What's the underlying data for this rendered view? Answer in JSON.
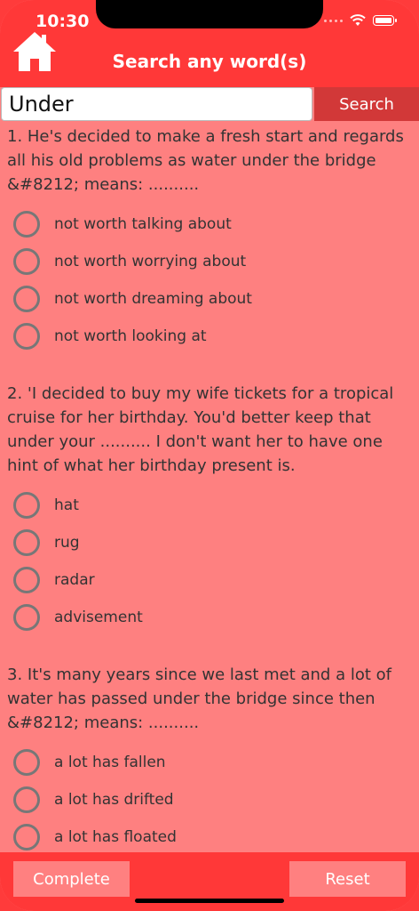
{
  "status": {
    "time": "10:30"
  },
  "header": {
    "title": "Search any word(s)"
  },
  "search": {
    "value": "Under",
    "button_label": "Search"
  },
  "questions": [
    {
      "text": "1. He's decided to make a fresh start and regards all his old problems as water under the bridge &#8212; means: ..........",
      "options": [
        "not worth talking about",
        "not worth worrying about",
        "not worth dreaming about",
        "not worth looking at"
      ]
    },
    {
      "text": "2. 'I decided to buy my wife tickets for a tropical cruise for her birthday. You'd better keep that under your .......... I don't want her to have one hint of what her birthday present is.",
      "options": [
        "hat",
        "rug",
        "radar",
        "advisement"
      ]
    },
    {
      "text": "3. It's many years since we last met and a lot of water has passed under the bridge since then &#8212; means: ..........",
      "options": [
        "a lot has fallen",
        "a lot has drifted",
        "a lot has floated"
      ]
    }
  ],
  "footer": {
    "complete_label": "Complete",
    "reset_label": "Reset"
  },
  "colors": {
    "header": "#ff3838",
    "background": "#fe8080",
    "search_button": "#d23838"
  }
}
